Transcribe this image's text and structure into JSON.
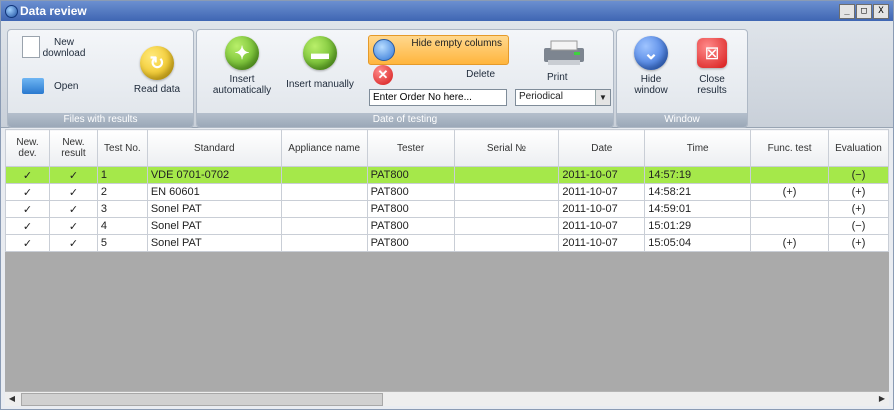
{
  "window": {
    "title": "Data review",
    "controls": [
      "_",
      "□",
      "X"
    ]
  },
  "ribbon": {
    "groups": [
      {
        "label": "Files with results"
      },
      {
        "label": "Date of testing"
      },
      {
        "label": "Window"
      }
    ],
    "buttons": {
      "new_download": "New\ndownload",
      "open": "Open",
      "read_data": "Read data",
      "insert_automatically": "Insert\nautomatically",
      "insert_manually": "Insert manually",
      "hide_empty_columns": "Hide empty\ncolumns",
      "delete": "Delete",
      "print": "Print",
      "hide_window": "Hide\nwindow",
      "close_results": "Close\nresults"
    },
    "order_input_placeholder": "Enter Order No here...",
    "period_select_value": "Periodical"
  },
  "table": {
    "columns": [
      "New. dev.",
      "New. result",
      "Test No.",
      "Standard",
      "Appliance name",
      "Tester",
      "Serial №",
      "Date",
      "Time",
      "Func. test",
      "Evaluation"
    ],
    "rows": [
      {
        "new_dev": "✓",
        "new_result": "✓",
        "test_no": "1",
        "standard": "VDE 0701-0702",
        "appliance": "",
        "tester": "PAT800",
        "serial": "",
        "date": "2011-10-07",
        "time": "14:57:19",
        "func": "",
        "eval": "(−)",
        "selected": true
      },
      {
        "new_dev": "✓",
        "new_result": "✓",
        "test_no": "2",
        "standard": "EN 60601",
        "appliance": "",
        "tester": "PAT800",
        "serial": "",
        "date": "2011-10-07",
        "time": "14:58:21",
        "func": "(+)",
        "eval": "(+)"
      },
      {
        "new_dev": "✓",
        "new_result": "✓",
        "test_no": "3",
        "standard": "Sonel PAT",
        "appliance": "",
        "tester": "PAT800",
        "serial": "",
        "date": "2011-10-07",
        "time": "14:59:01",
        "func": "",
        "eval": "(+)"
      },
      {
        "new_dev": "✓",
        "new_result": "✓",
        "test_no": "4",
        "standard": "Sonel PAT",
        "appliance": "",
        "tester": "PAT800",
        "serial": "",
        "date": "2011-10-07",
        "time": "15:01:29",
        "func": "",
        "eval": "(−)"
      },
      {
        "new_dev": "✓",
        "new_result": "✓",
        "test_no": "5",
        "standard": "Sonel PAT",
        "appliance": "",
        "tester": "PAT800",
        "serial": "",
        "date": "2011-10-07",
        "time": "15:05:04",
        "func": "(+)",
        "eval": "(+)"
      }
    ]
  },
  "colors": {
    "selected_row": "#a5e84a",
    "hide_columns_active": "#ffb53d",
    "titlebar": "#3f66b3"
  }
}
